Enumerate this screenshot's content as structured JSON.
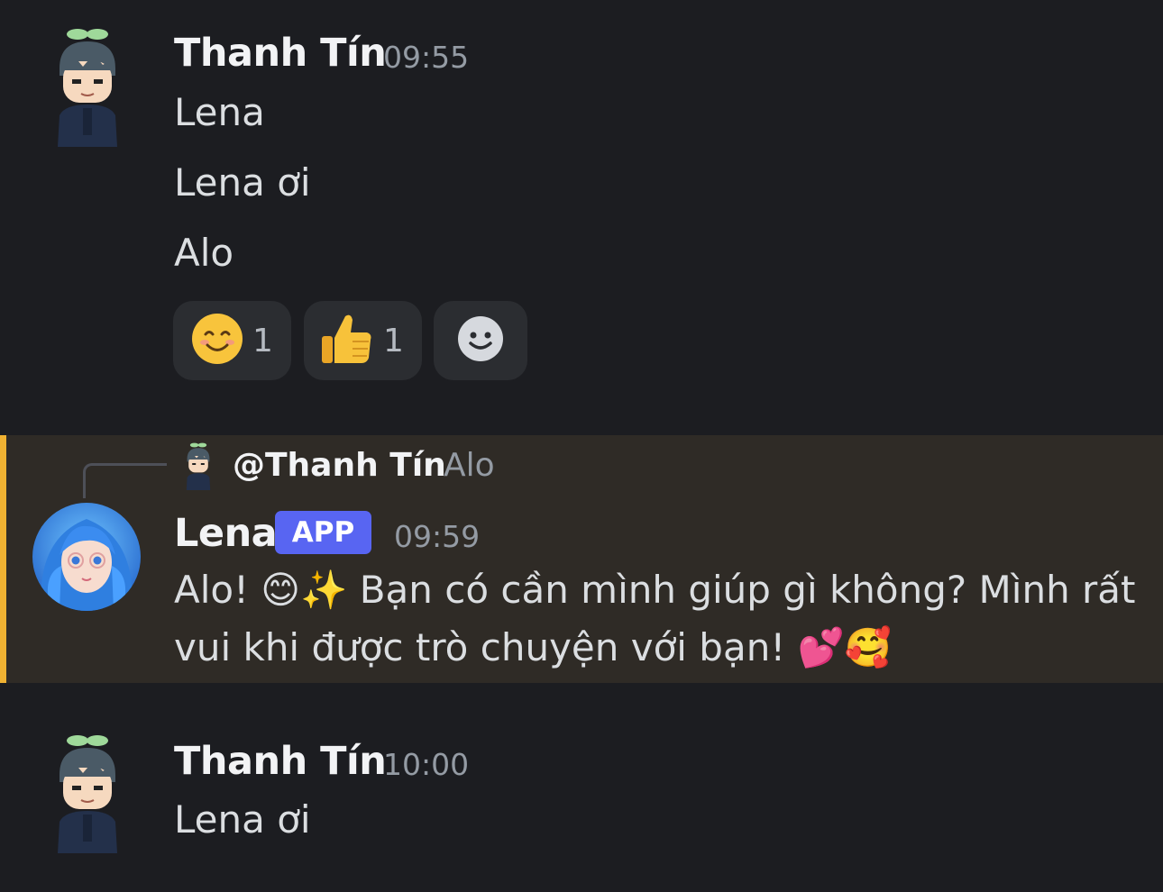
{
  "messages": [
    {
      "author": "Thanh Tín",
      "time": "09:55",
      "lines": [
        "Lena",
        "Lena ơi",
        "Alo"
      ],
      "reactions": [
        {
          "emoji": "smiling-face-emoji",
          "count": "1"
        },
        {
          "emoji": "thumbs-up-emoji",
          "count": "1"
        },
        {
          "emoji": "add-reaction-icon"
        }
      ]
    },
    {
      "author": "Lena",
      "badge": "APP",
      "time": "09:59",
      "reply": {
        "mention": "@Thanh Tín",
        "preview": "Alo"
      },
      "lines": [
        "Alo! 😊✨ Bạn có cần mình giúp gì không? Mình rất",
        "vui khi được trò chuyện với bạn! 💕🥰"
      ]
    },
    {
      "author": "Thanh Tín",
      "time": "10:00",
      "lines": [
        "Lena ơi"
      ]
    }
  ],
  "colors": {
    "background": "#1c1d21",
    "highlight": "#2f2b26",
    "highlight_bar": "#f0b232",
    "badge": "#5865f2"
  }
}
